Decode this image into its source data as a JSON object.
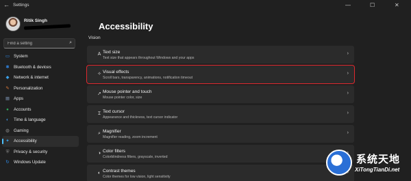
{
  "window": {
    "title": "Settings",
    "back_icon": "back-arrow-icon",
    "controls": [
      "minimize",
      "maximize",
      "close"
    ],
    "control_glyphs": {
      "minimize": "—",
      "maximize": "☐",
      "close": "✕"
    }
  },
  "user": {
    "name": "Ritik Singh"
  },
  "search": {
    "placeholder": "Find a setting",
    "icon": "search-icon",
    "glyph": "⌕"
  },
  "sidebar": {
    "items": [
      {
        "label": "System",
        "icon": "monitor-icon",
        "glyph": "▭",
        "color": "#2e8ae6",
        "active": false
      },
      {
        "label": "Bluetooth & devices",
        "icon": "bluetooth-icon",
        "glyph": "✱",
        "color": "#2f7fd8",
        "active": false
      },
      {
        "label": "Network & internet",
        "icon": "wifi-icon",
        "glyph": "◆",
        "color": "#3aa0e8",
        "active": false
      },
      {
        "label": "Personalization",
        "icon": "brush-icon",
        "glyph": "✎",
        "color": "#e07a3a",
        "active": false
      },
      {
        "label": "Apps",
        "icon": "apps-icon",
        "glyph": "▦",
        "color": "#6b7f99",
        "active": false
      },
      {
        "label": "Accounts",
        "icon": "person-icon",
        "glyph": "●",
        "color": "#2fa55a",
        "active": false
      },
      {
        "label": "Time & language",
        "icon": "globe-icon",
        "glyph": "◐",
        "color": "#3b8ed9",
        "active": false
      },
      {
        "label": "Gaming",
        "icon": "controller-icon",
        "glyph": "◍",
        "color": "#8c8c8c",
        "active": false
      },
      {
        "label": "Accessibility",
        "icon": "accessibility-icon",
        "glyph": "✦",
        "color": "#3a9be0",
        "active": true
      },
      {
        "label": "Privacy & security",
        "icon": "shield-icon",
        "glyph": "⛨",
        "color": "#8c8c8c",
        "active": false
      },
      {
        "label": "Windows Update",
        "icon": "update-icon",
        "glyph": "↻",
        "color": "#2e8ae6",
        "active": false
      }
    ]
  },
  "page": {
    "title": "Accessibility",
    "section": "Vision"
  },
  "cards": [
    {
      "title": "Text size",
      "desc": "Text size that appears throughout Windows and your apps",
      "icon": "text-size-icon",
      "glyph": "A",
      "highlight": false
    },
    {
      "title": "Visual effects",
      "desc": "Scroll bars, transparency, animations, notification timeout",
      "icon": "visual-effects-icon",
      "glyph": "✧",
      "highlight": true
    },
    {
      "title": "Mouse pointer and touch",
      "desc": "Mouse pointer color, size",
      "icon": "mouse-pointer-icon",
      "glyph": "➚",
      "highlight": false
    },
    {
      "title": "Text cursor",
      "desc": "Appearance and thickness, text cursor indicator",
      "icon": "text-cursor-icon",
      "glyph": "Ɪ",
      "highlight": false
    },
    {
      "title": "Magnifier",
      "desc": "Magnifier reading, zoom increment",
      "icon": "magnifier-icon",
      "glyph": "⌕",
      "highlight": false
    },
    {
      "title": "Color filters",
      "desc": "Colorblindness filters, grayscale, inverted",
      "icon": "color-filters-icon",
      "glyph": "◑",
      "highlight": false
    },
    {
      "title": "Contrast themes",
      "desc": "Color themes for low vision, light sensitivity",
      "icon": "contrast-icon",
      "glyph": "◐",
      "highlight": false
    }
  ],
  "chevron_glyph": "›",
  "watermark": {
    "main": "系统天地",
    "sub": "XiTongTianDi.net"
  },
  "colors": {
    "accent": "#4cc2ff",
    "highlight_border": "#e0282e",
    "background": "#202020",
    "card": "#2b2b2b"
  }
}
